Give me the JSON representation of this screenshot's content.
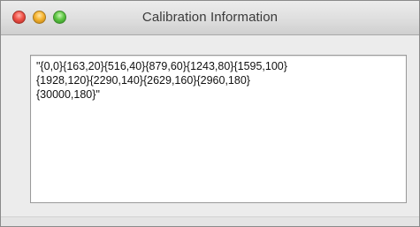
{
  "window": {
    "title": "Calibration Information",
    "controls": {
      "close": "close-button",
      "minimize": "minimize-button",
      "zoom": "zoom-button"
    }
  },
  "content": {
    "text": "\"{0,0}{163,20}{516,40}{879,60}{1243,80}{1595,100}\n{1928,120}{2290,140}{2629,160}{2960,180}\n{30000,180}\""
  },
  "colors": {
    "close": "#f0544a",
    "minimize": "#f6b431",
    "zoom": "#5fc745"
  }
}
